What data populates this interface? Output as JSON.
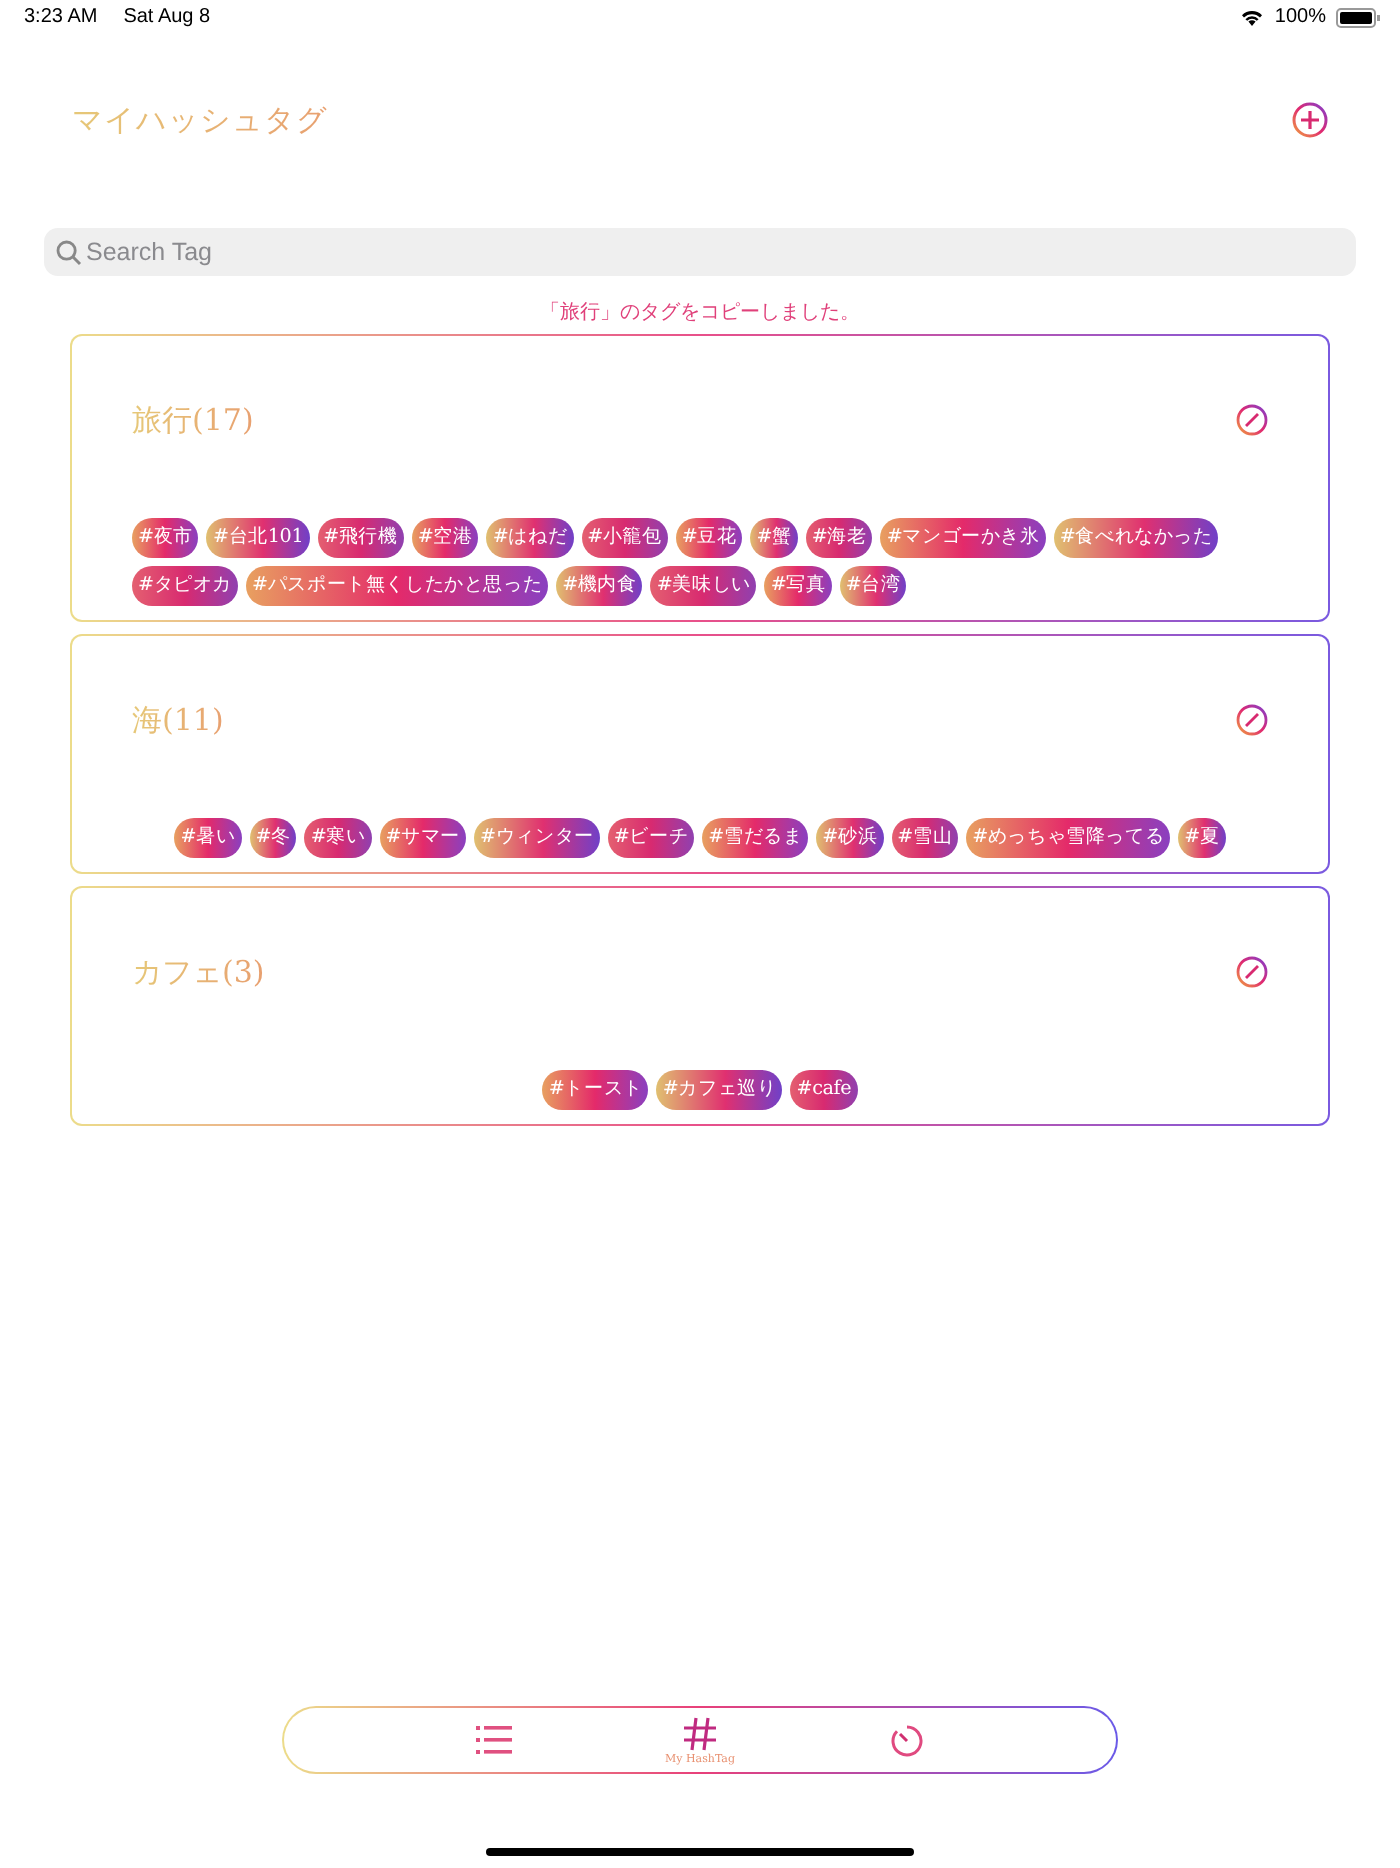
{
  "status_bar": {
    "time": "3:23 AM",
    "date": "Sat Aug 8",
    "battery": "100%"
  },
  "header": {
    "title": "マイハッシュタグ"
  },
  "search": {
    "placeholder": "Search Tag"
  },
  "message": "「旅行」のタグをコピーしました。",
  "groups": [
    {
      "title": "旅行(17)",
      "tags": [
        "#夜市",
        "#台北101",
        "#飛行機",
        "#空港",
        "#はねだ",
        "#小籠包",
        "#豆花",
        "#蟹",
        "#海老",
        "#マンゴーかき氷",
        "#食べれなかった",
        "#タピオカ",
        "#パスポート無くしたかと思った",
        "#機内食",
        "#美味しい",
        "#写真",
        "#台湾"
      ]
    },
    {
      "title": "海(11)",
      "tags": [
        "#暑い",
        "#冬",
        "#寒い",
        "#サマー",
        "#ウィンター",
        "#ビーチ",
        "#雪だるま",
        "#砂浜",
        "#雪山",
        "#めっちゃ雪降ってる",
        "#夏"
      ]
    },
    {
      "title": "カフェ(3)",
      "tags": [
        "#トースト",
        "#カフェ巡り",
        "#cafe"
      ]
    }
  ],
  "tab_bar": [
    {
      "kind": "list",
      "selected": false
    },
    {
      "kind": "hashtag",
      "label": "My HashTag",
      "selected": true
    },
    {
      "kind": "timer",
      "selected": false
    }
  ]
}
